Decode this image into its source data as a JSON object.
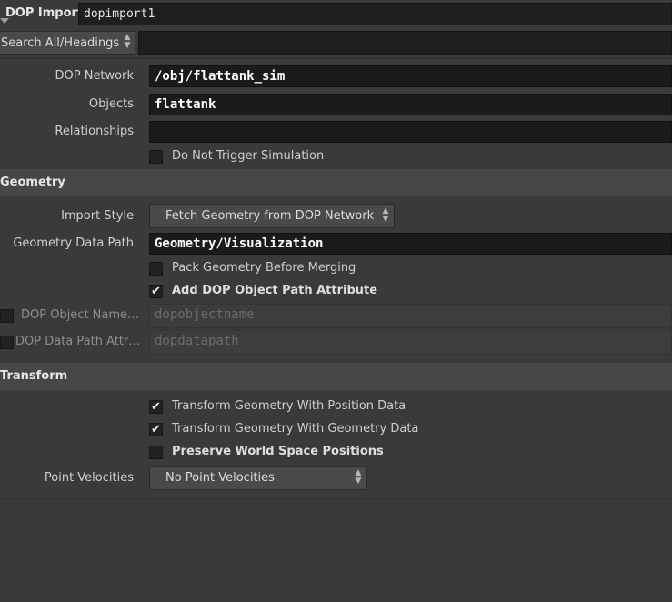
{
  "header": {
    "node_type": "DOP Import",
    "node_name": "dopimport1"
  },
  "search": {
    "mode": "Search All/Headings",
    "query": ""
  },
  "params": {
    "dop_network": {
      "label": "DOP Network",
      "value": "/obj/flattank_sim"
    },
    "objects": {
      "label": "Objects",
      "value": "flattank"
    },
    "relationships": {
      "label": "Relationships",
      "value": ""
    },
    "do_not_trigger": {
      "label": "Do Not Trigger Simulation",
      "checked": false
    }
  },
  "geometry": {
    "heading": "Geometry",
    "import_style": {
      "label": "Import Style",
      "value": "Fetch Geometry from DOP Network"
    },
    "data_path": {
      "label": "Geometry Data Path",
      "value": "Geometry/Visualization"
    },
    "pack": {
      "label": "Pack Geometry Before Merging",
      "checked": false
    },
    "add_path": {
      "label": "Add DOP Object Path Attribute",
      "checked": true
    },
    "obj_name": {
      "label": "DOP Object Name…",
      "placeholder": "dopobjectname",
      "checked": false
    },
    "data_path_attr": {
      "label": "DOP Data Path Attr…",
      "placeholder": "dopdatapath",
      "checked": false
    }
  },
  "transform": {
    "heading": "Transform",
    "with_position": {
      "label": "Transform Geometry With Position Data",
      "checked": true
    },
    "with_geometry": {
      "label": "Transform Geometry With Geometry Data",
      "checked": true
    },
    "preserve_world": {
      "label": "Preserve World Space Positions",
      "checked": false
    },
    "point_velocities": {
      "label": "Point Velocities",
      "value": "No Point Velocities"
    }
  },
  "glyphs": {
    "check": "✔",
    "updown": "▲▼"
  }
}
